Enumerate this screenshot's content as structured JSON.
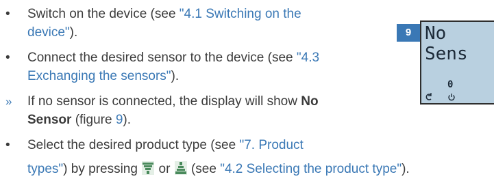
{
  "steps": [
    {
      "marker": "•",
      "lines": [
        {
          "text": "Switch on the device (see ",
          "link": "\"4.1 Switching on the"
        },
        {
          "link": "device\"",
          "text_after": ")."
        }
      ]
    },
    {
      "marker": "•",
      "lines": [
        {
          "text": "Connect the desired sensor to the device (see ",
          "link": "\"4.3"
        },
        {
          "link": "Exchanging the sensors\"",
          "text_after": ")."
        }
      ]
    },
    {
      "marker": "»",
      "lines": [
        {
          "text": "If no sensor is connected, the display will show ",
          "bold": "No"
        },
        {
          "bold": "Sensor",
          "text_after": " (figure ",
          "link": "9",
          "text_end": ")."
        }
      ]
    },
    {
      "marker": "•",
      "lines": [
        {
          "text": "Select the desired product type (see ",
          "link": "\"7. Product"
        },
        {
          "link": "types\"",
          "text_after": ") by pressing ",
          "text_or": " or ",
          "text_see": " (see ",
          "link2": "\"4.2 Selecting the product type\"",
          "text_end": ")."
        }
      ]
    }
  ],
  "figure": {
    "number": "9",
    "display_text": "No Sens",
    "display_value": "0",
    "left_icon": "rotate-icon",
    "right_icon": "power-icon"
  },
  "colors": {
    "link": "#3a78b5",
    "text": "#3b3b3b",
    "lcd_background": "#b9d0e0",
    "lcd_text": "#1c2a38",
    "button_icon": "#2e7d4a"
  }
}
